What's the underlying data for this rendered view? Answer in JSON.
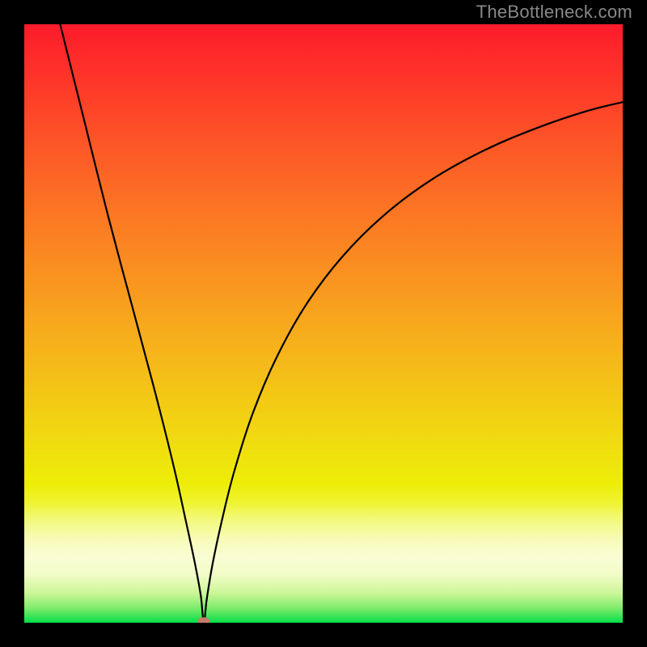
{
  "watermark": "TheBottleneck.com",
  "chart_data": {
    "type": "line",
    "title": "",
    "xlabel": "",
    "ylabel": "",
    "xlim": [
      0,
      100
    ],
    "ylim": [
      0,
      100
    ],
    "grid": false,
    "legend": false,
    "marker": {
      "x": 30,
      "y": 0,
      "color": "#c77b6b"
    },
    "series": [
      {
        "name": "curve",
        "color": "#000000",
        "x": [
          6,
          10,
          14,
          18,
          22,
          25,
          27,
          28.5,
          29.5,
          30,
          30.5,
          31.5,
          33,
          35,
          38,
          42,
          47,
          53,
          60,
          68,
          77,
          86,
          94,
          100
        ],
        "y": [
          100,
          84,
          68,
          53,
          38,
          26,
          17,
          10,
          4.5,
          0,
          4,
          10,
          17,
          25,
          34.5,
          44,
          53,
          61,
          68,
          74,
          79,
          82.8,
          85.5,
          87
        ]
      }
    ],
    "background_gradient": {
      "stops": [
        {
          "pos": 0.0,
          "hex": "#fd1b2b"
        },
        {
          "pos": 0.1,
          "hex": "#fe3829"
        },
        {
          "pos": 0.2,
          "hex": "#fd5627"
        },
        {
          "pos": 0.3,
          "hex": "#fc7224"
        },
        {
          "pos": 0.4,
          "hex": "#fa8d21"
        },
        {
          "pos": 0.5,
          "hex": "#f7a81d"
        },
        {
          "pos": 0.6,
          "hex": "#f4c217"
        },
        {
          "pos": 0.7,
          "hex": "#f0dc0f"
        },
        {
          "pos": 0.77,
          "hex": "#edee08"
        },
        {
          "pos": 0.8,
          "hex": "#eef432"
        },
        {
          "pos": 0.83,
          "hex": "#f3f981"
        },
        {
          "pos": 0.86,
          "hex": "#f7fbb7"
        },
        {
          "pos": 0.89,
          "hex": "#f9fdd4"
        },
        {
          "pos": 0.92,
          "hex": "#f1fcc6"
        },
        {
          "pos": 0.95,
          "hex": "#ccf698"
        },
        {
          "pos": 0.975,
          "hex": "#81ec6c"
        },
        {
          "pos": 1.0,
          "hex": "#06de48"
        }
      ]
    }
  }
}
